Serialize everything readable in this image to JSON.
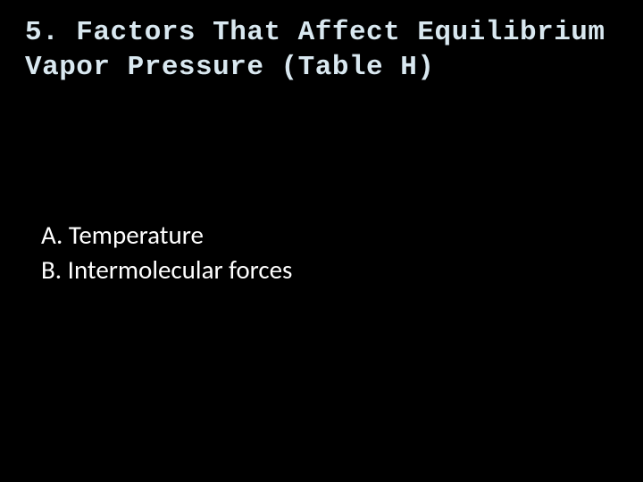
{
  "heading": {
    "line1": "5. Factors That Affect Equilibrium",
    "line2": "Vapor Pressure (Table H)"
  },
  "body": {
    "itemA": "A. Temperature",
    "itemB": "B. Intermolecular forces"
  }
}
